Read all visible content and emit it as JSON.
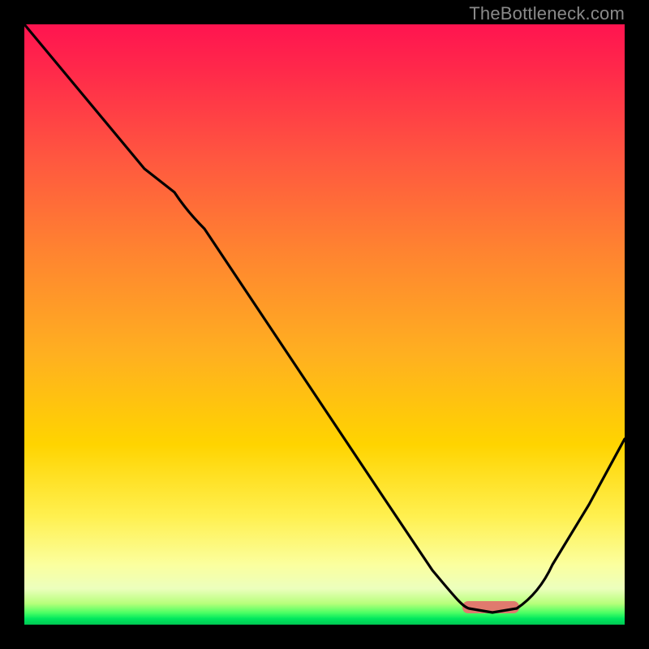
{
  "watermark": "TheBottleneck.com",
  "colors": {
    "top": "#ff1450",
    "mid": "#ffd400",
    "bottom": "#00c853",
    "curve": "#000000",
    "sweet_spot": "#e07a6e",
    "frame": "#000000"
  },
  "chart_data": {
    "type": "line",
    "title": "",
    "xlabel": "",
    "ylabel": "",
    "xlim": [
      0,
      100
    ],
    "ylim": [
      0,
      100
    ],
    "note": "Axes are unlabeled in the image; values below are read off by pixel position, normalized 0-100. y=100 is top (worst / red), y=0 is bottom (best / green). The curve descends from top-left, flattens near the bottom around x≈73-82 (the marked sweet spot), then rises toward the right edge.",
    "series": [
      {
        "name": "bottleneck-curve",
        "x": [
          0,
          10,
          20,
          25,
          30,
          40,
          50,
          60,
          68,
          73,
          78,
          82,
          88,
          94,
          100
        ],
        "y": [
          100,
          88,
          76,
          72,
          66,
          51,
          36,
          21,
          9,
          3,
          2,
          3,
          10,
          20,
          31
        ]
      }
    ],
    "annotations": [
      {
        "name": "sweet-spot-bar",
        "x_start": 73,
        "x_end": 82,
        "y": 2.5
      }
    ]
  }
}
